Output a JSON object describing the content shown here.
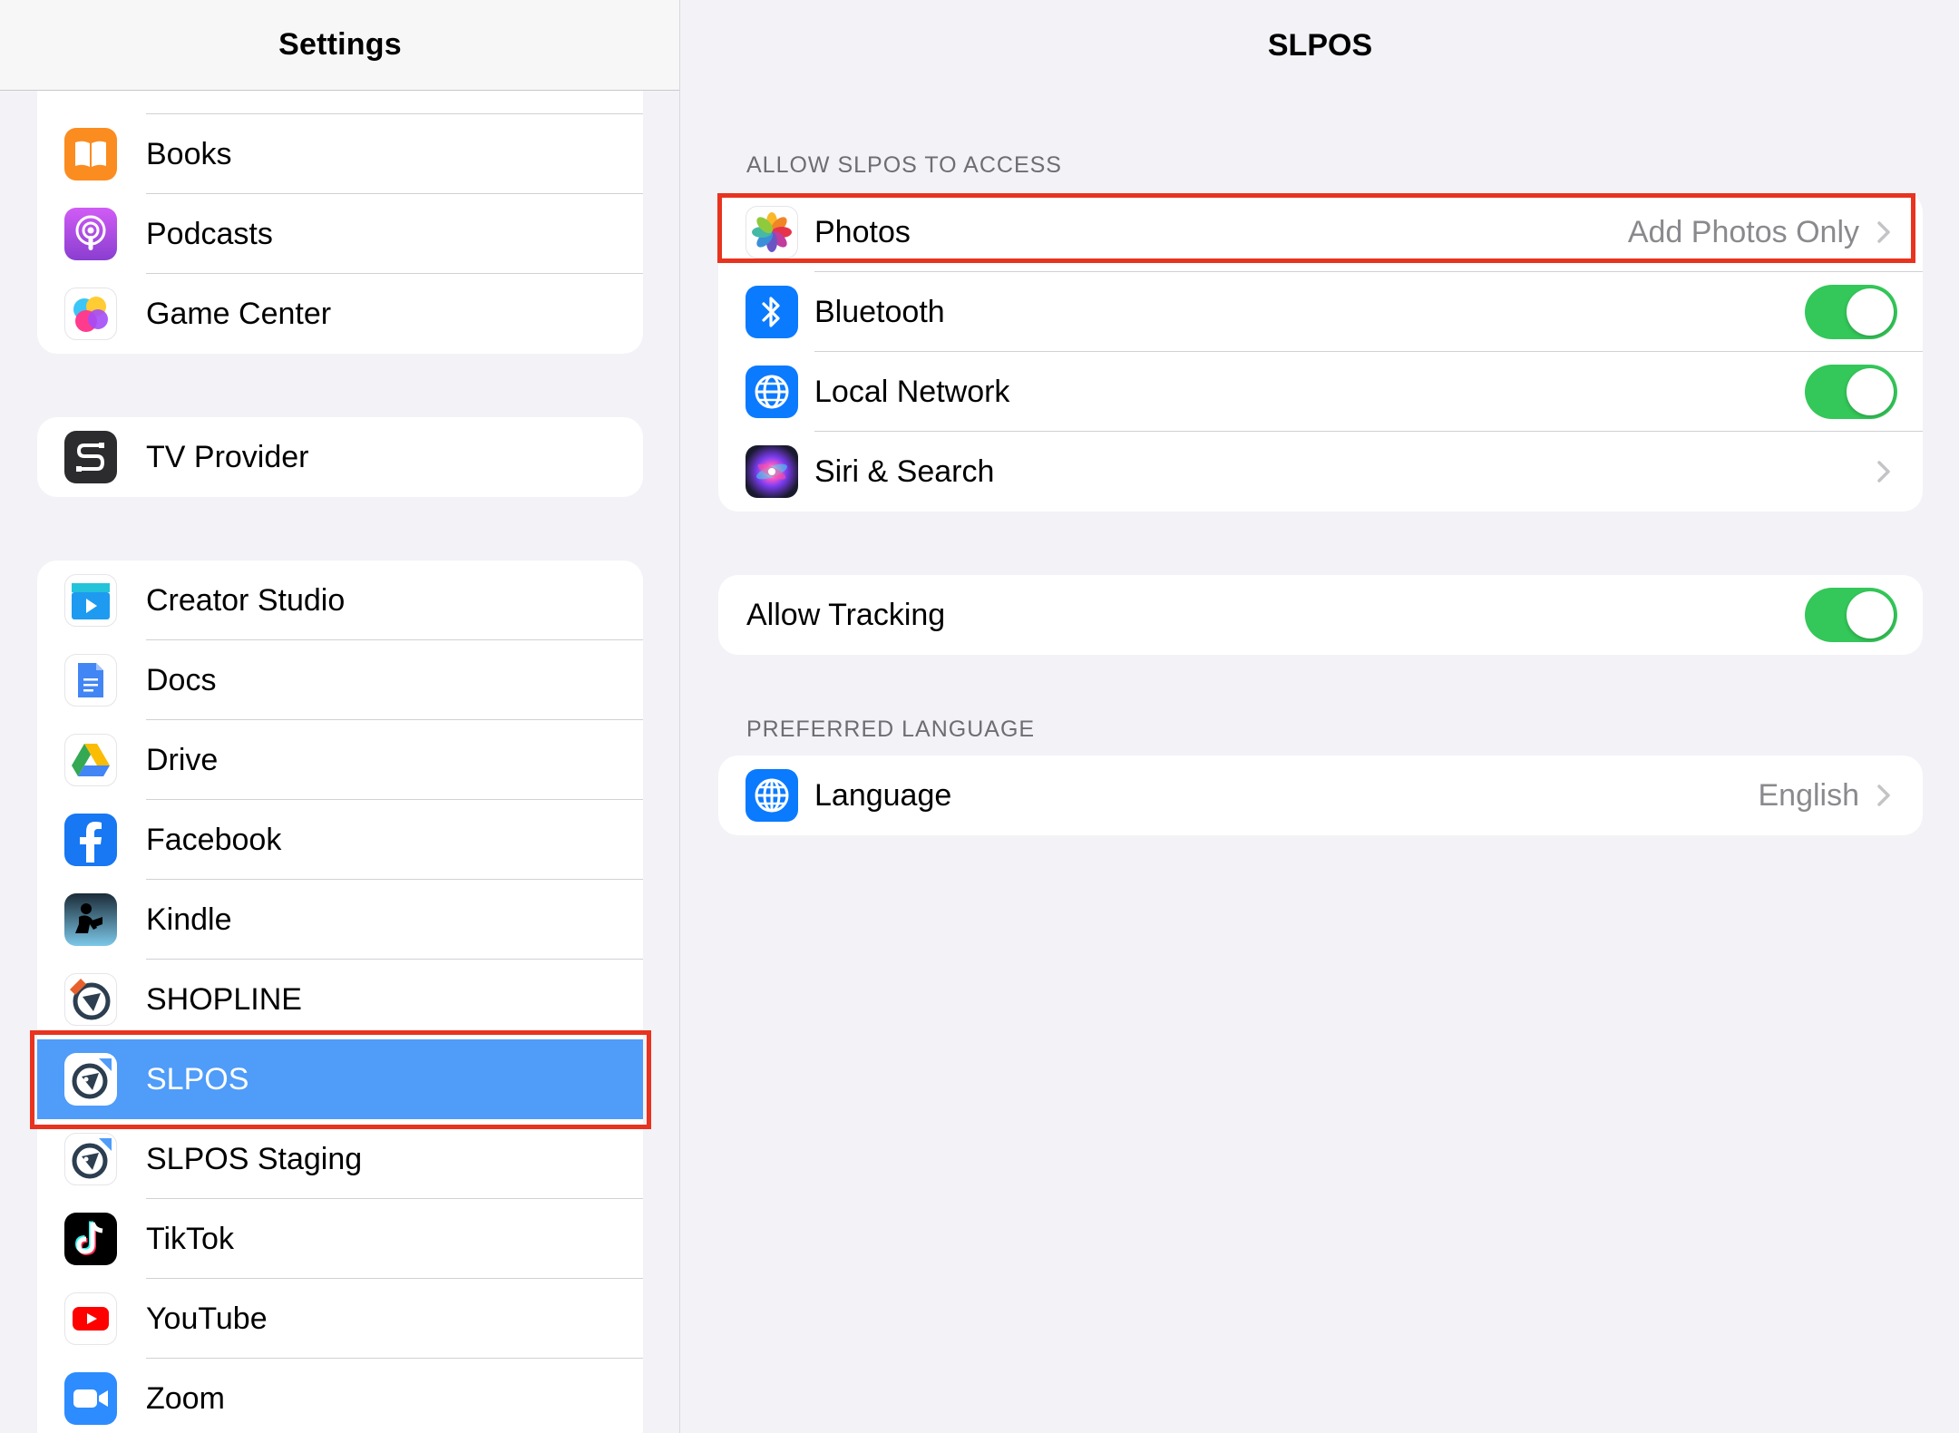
{
  "sidebar": {
    "title": "Settings",
    "groups": [
      {
        "items": [
          {
            "label": "Books",
            "icon": "books-icon",
            "color": "#fb8c1f"
          },
          {
            "label": "Podcasts",
            "icon": "podcasts-icon",
            "color": "#a64fe0"
          },
          {
            "label": "Game Center",
            "icon": "game-center-icon",
            "color": "#ffffff"
          }
        ]
      },
      {
        "items": [
          {
            "label": "TV Provider",
            "icon": "tv-provider-icon",
            "color": "#2c2c2e"
          }
        ]
      },
      {
        "items": [
          {
            "label": "Creator Studio",
            "icon": "creator-studio-icon",
            "color": "#1e9bf0"
          },
          {
            "label": "Docs",
            "icon": "docs-icon",
            "color": "#4285f4"
          },
          {
            "label": "Drive",
            "icon": "drive-icon",
            "color": "#ffffff"
          },
          {
            "label": "Facebook",
            "icon": "facebook-icon",
            "color": "#1877f2"
          },
          {
            "label": "Kindle",
            "icon": "kindle-icon",
            "color": "#8ad3f0"
          },
          {
            "label": "SHOPLINE",
            "icon": "shopline-icon",
            "color": "#ffffff"
          },
          {
            "label": "SLPOS",
            "icon": "slpos-icon",
            "color": "#ffffff",
            "selected": true
          },
          {
            "label": "SLPOS Staging",
            "icon": "slpos-staging-icon",
            "color": "#ffffff"
          },
          {
            "label": "TikTok",
            "icon": "tiktok-icon",
            "color": "#000000"
          },
          {
            "label": "YouTube",
            "icon": "youtube-icon",
            "color": "#ff0000"
          },
          {
            "label": "Zoom",
            "icon": "zoom-icon",
            "color": "#2d8cff"
          }
        ]
      }
    ],
    "selected_color": "#4f9cf9"
  },
  "detail": {
    "title": "SLPOS",
    "access_section": "ALLOW SLPOS  TO ACCESS",
    "access_rows": [
      {
        "label": "Photos",
        "value": "Add Photos Only",
        "icon": "photos-icon",
        "kind": "chevron"
      },
      {
        "label": "Bluetooth",
        "icon": "bluetooth-icon",
        "kind": "toggle",
        "on": true
      },
      {
        "label": "Local Network",
        "icon": "local-network-icon",
        "kind": "toggle",
        "on": true
      },
      {
        "label": "Siri & Search",
        "icon": "siri-icon",
        "kind": "chevron"
      }
    ],
    "tracking_label": "Allow Tracking",
    "tracking_on": true,
    "language_section": "PREFERRED LANGUAGE",
    "language_label": "Language",
    "language_value": "English",
    "toggle_color": "#34c759",
    "highlight_color": "#e8331f"
  }
}
